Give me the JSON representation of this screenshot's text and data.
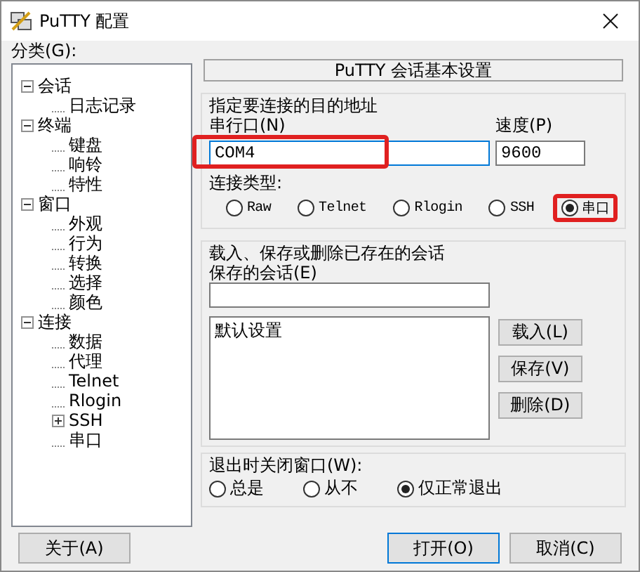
{
  "window": {
    "title": "PuTTY 配置"
  },
  "category_label": "分类(G):",
  "tree": [
    {
      "label": "会话",
      "expanded": true,
      "children": [
        {
          "label": "日志记录"
        }
      ]
    },
    {
      "label": "终端",
      "expanded": true,
      "children": [
        {
          "label": "键盘"
        },
        {
          "label": "响铃"
        },
        {
          "label": "特性"
        }
      ]
    },
    {
      "label": "窗口",
      "expanded": true,
      "children": [
        {
          "label": "外观"
        },
        {
          "label": "行为"
        },
        {
          "label": "转换"
        },
        {
          "label": "选择"
        },
        {
          "label": "颜色"
        }
      ]
    },
    {
      "label": "连接",
      "expanded": true,
      "children": [
        {
          "label": "数据"
        },
        {
          "label": "代理"
        },
        {
          "label": "Telnet"
        },
        {
          "label": "Rlogin"
        },
        {
          "label": "SSH",
          "expanded": false
        },
        {
          "label": "串口"
        }
      ]
    }
  ],
  "panel_title": "PuTTY 会话基本设置",
  "destination": {
    "title": "指定要连接的目的地址",
    "port_label": "串行口(N)",
    "port_value": "COM4",
    "port_highlighted": true,
    "speed_label": "速度(P)",
    "speed_value": "9600",
    "type_label": "连接类型:",
    "types": [
      {
        "label": "Raw",
        "selected": false,
        "highlighted": false
      },
      {
        "label": "Telnet",
        "selected": false,
        "highlighted": false
      },
      {
        "label": "Rlogin",
        "selected": false,
        "highlighted": false
      },
      {
        "label": "SSH",
        "selected": false,
        "highlighted": false
      },
      {
        "label": "串口",
        "selected": true,
        "highlighted": true
      }
    ]
  },
  "sessions": {
    "title": "载入、保存或删除已存在的会话",
    "saved_label": "保存的会话(E)",
    "list": [
      "默认设置"
    ],
    "buttons": [
      "载入(L)",
      "保存(V)",
      "删除(D)"
    ]
  },
  "close_on_exit": {
    "title": "退出时关闭窗口(W):",
    "options": [
      {
        "label": "总是",
        "selected": false
      },
      {
        "label": "从不",
        "selected": false
      },
      {
        "label": "仅正常退出",
        "selected": true
      }
    ]
  },
  "footer": {
    "about": "关于(A)",
    "open": "打开(O)",
    "cancel": "取消(C)"
  }
}
